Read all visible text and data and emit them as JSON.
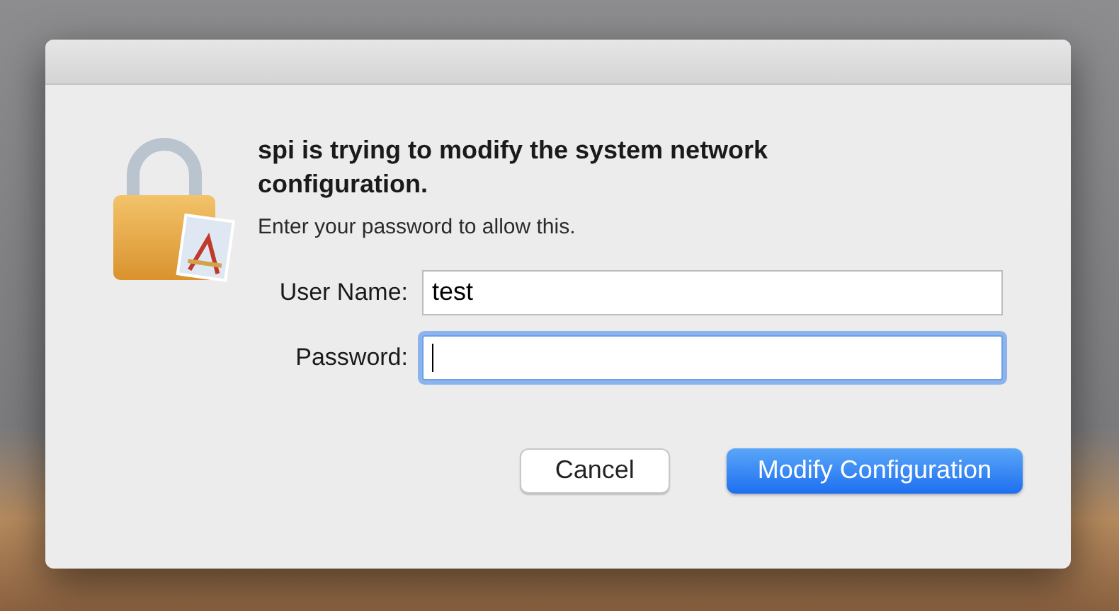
{
  "dialog": {
    "heading": "spi is trying to modify the system network configuration.",
    "message": "Enter your password to allow this.",
    "fields": [
      {
        "label": "User Name:",
        "value": "test",
        "focused": false
      },
      {
        "label": "Password:",
        "focused": true
      }
    ],
    "buttons": [
      {
        "label": "Cancel",
        "primary": false
      },
      {
        "label": "Modify Configuration",
        "primary": true
      }
    ]
  }
}
